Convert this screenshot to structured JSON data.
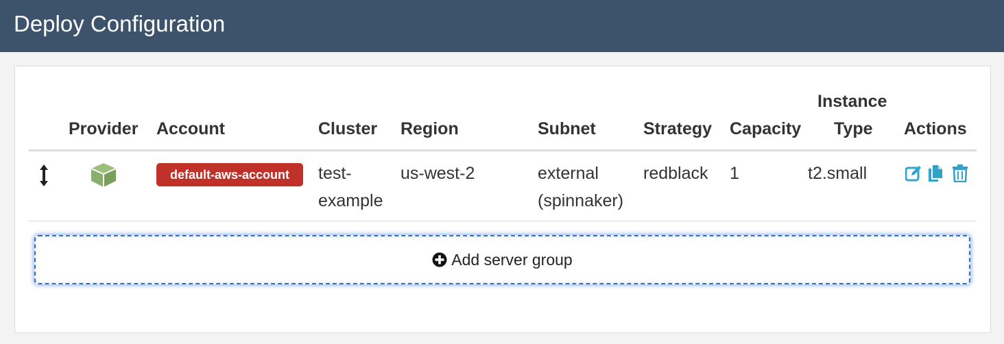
{
  "header": {
    "title": "Deploy Configuration"
  },
  "table": {
    "columns": {
      "provider": "Provider",
      "account": "Account",
      "cluster": "Cluster",
      "region": "Region",
      "subnet": "Subnet",
      "strategy": "Strategy",
      "capacity": "Capacity",
      "instance_type_line1": "Instance",
      "instance_type_line2": "Type",
      "actions": "Actions"
    },
    "rows": [
      {
        "provider_icon": "aws-cube-icon",
        "account": "default-aws-account",
        "cluster_line1": "test-",
        "cluster_line2": "example",
        "region": "us-west-2",
        "subnet_line1": "external",
        "subnet_line2": "(spinnaker)",
        "strategy": "redblack",
        "capacity": "1",
        "instance_type": "t2.small",
        "actions": [
          "edit-icon",
          "copy-icon",
          "trash-icon"
        ]
      }
    ]
  },
  "add_server_group": {
    "label": "Add server group",
    "icon": "plus-circle-icon"
  },
  "colors": {
    "header_bg": "#3d536c",
    "account_badge": "#c0312a",
    "provider_icon": "#8aae6b",
    "action_icon": "#2fa4c8",
    "focus_outline": "#3b6fb0"
  }
}
